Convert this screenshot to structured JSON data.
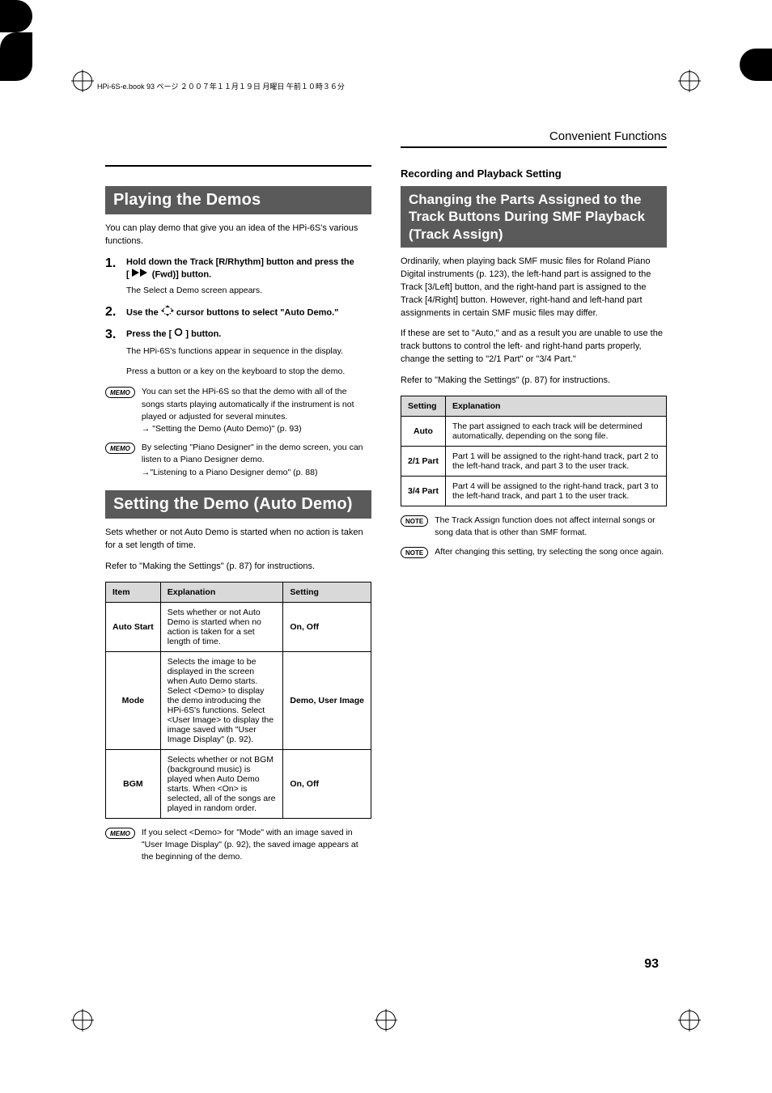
{
  "header": {
    "crop_text": "HPi-6S-e.book 93 ページ ２００７年１１月１９日 月曜日 午前１０時３６分"
  },
  "running_head": "Convenient Functions",
  "page_number": "93",
  "badges": {
    "memo": "MEMO",
    "note": "NOTE"
  },
  "left": {
    "sec1": {
      "title": "Playing the Demos",
      "intro": "You can play demo that give you an idea of the HPi-6S's various functions.",
      "step1": {
        "num": "1.",
        "title_a": "Hold down the Track [R/Rhythm] button and press the",
        "title_b": "[",
        "title_c": " (Fwd)] button.",
        "body": "The Select a Demo screen appears."
      },
      "step2": {
        "num": "2.",
        "title_a": "Use the ",
        "title_b": " cursor buttons to select \"Auto Demo.\""
      },
      "step3": {
        "num": "3.",
        "title_a": "Press the [ ",
        "title_b": " ] button.",
        "body1": "The HPi-6S's functions appear in sequence in the display.",
        "body2": "Press a button or a key on the keyboard to stop the demo."
      },
      "memo1": "You can set the HPi-6S so that the demo with all of the songs starts playing automatically if the instrument is not played or adjusted for several minutes.",
      "memo1_ref": "→ \"Setting the Demo (Auto Demo)\" (p. 93)",
      "memo2": "By selecting \"Piano Designer\" in the demo screen, you can listen to a Piano Designer demo.",
      "memo2_ref": "→\"Listening to a Piano Designer demo\" (p. 88)"
    },
    "sec2": {
      "title": "Setting the Demo (Auto Demo)",
      "intro": "Sets whether or not Auto Demo is started when no action is taken for a set length of time.",
      "ref": "Refer to \"Making the Settings\" (p. 87) for instructions.",
      "table": {
        "headers": {
          "item": "Item",
          "explanation": "Explanation",
          "setting": "Setting"
        },
        "rows": [
          {
            "item": "Auto Start",
            "exp": "Sets whether or not Auto Demo is started when no action is taken for a set length of time.",
            "set": "On, Off"
          },
          {
            "item": "Mode",
            "exp": "Selects the image to be displayed in the screen when Auto Demo starts. Select <Demo> to display the demo introducing the HPi-6S's functions. Select <User Image> to display the image saved with \"User Image Display\" (p. 92).",
            "set": "Demo, User Image"
          },
          {
            "item": "BGM",
            "exp": "Selects whether or not BGM (background music) is played when Auto Demo starts. When <On> is selected, all of the songs are played in random order.",
            "set": "On, Off"
          }
        ]
      },
      "memo": "If you select <Demo> for \"Mode\" with an image saved in \"User Image Display\" (p. 92), the saved image appears at the beginning of the demo."
    }
  },
  "right": {
    "cat": "Recording and Playback Setting",
    "sec": {
      "title": "Changing the Parts Assigned to the Track Buttons During SMF Playback (Track Assign)",
      "p1": "Ordinarily, when playing back SMF music files for Roland Piano Digital instruments (p. 123), the left-hand part is assigned to the Track [3/Left] button, and the right-hand part is assigned to the Track [4/Right] button. However, right-hand and left-hand part assignments in certain SMF music files may differ.",
      "p2": "If these are set to \"Auto,\" and as a result you are unable to use the track buttons to control the left- and right-hand parts properly, change the setting to \"2/1 Part\" or \"3/4 Part.\"",
      "ref": "Refer to \"Making the Settings\" (p. 87) for instructions.",
      "table": {
        "headers": {
          "setting": "Setting",
          "explanation": "Explanation"
        },
        "rows": [
          {
            "set": "Auto",
            "exp": "The part assigned to each track will be determined automatically, depending on the song file."
          },
          {
            "set": "2/1 Part",
            "exp": "Part 1 will be assigned to the right-hand track, part 2 to the left-hand track, and part 3 to the user track."
          },
          {
            "set": "3/4 Part",
            "exp": "Part 4 will be assigned to the right-hand track, part 3 to the left-hand track, and part 1 to the user track."
          }
        ]
      },
      "note1": "The Track Assign function does not affect internal songs or song data that is other than SMF format.",
      "note2": "After changing this setting, try selecting the song once again."
    }
  }
}
